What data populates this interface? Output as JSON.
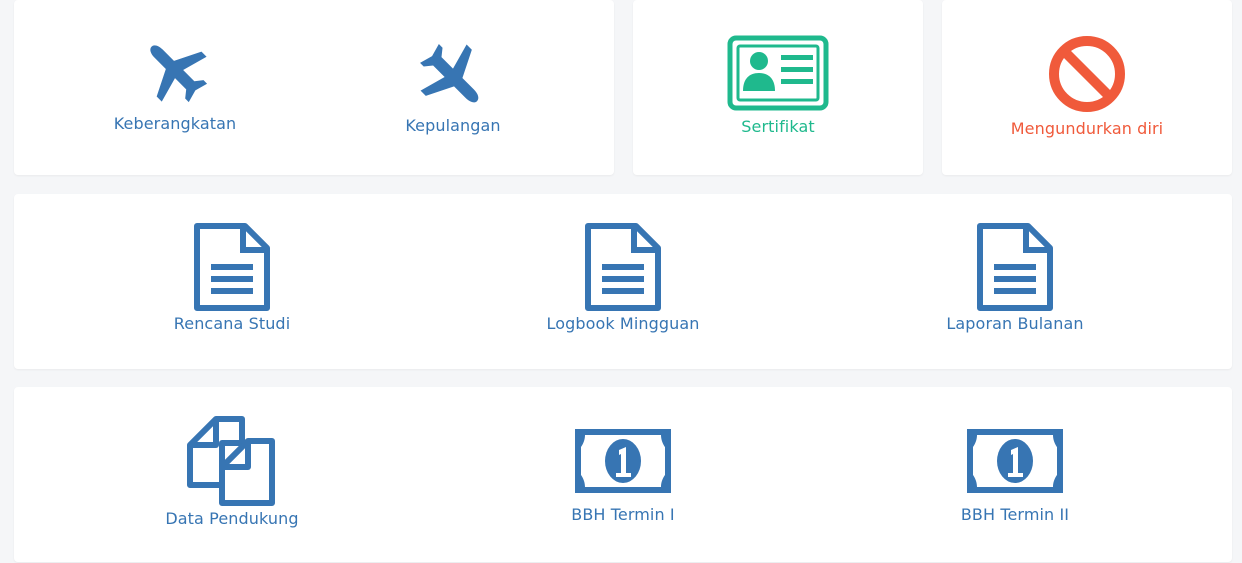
{
  "colors": {
    "primary": "#3775b3",
    "success": "#1fb98d",
    "danger": "#f05a3b",
    "background": "#f5f6f8",
    "card": "#ffffff"
  },
  "travel": {
    "departure": {
      "label": "Keberangkatan",
      "icon": "plane-departure-icon"
    },
    "return": {
      "label": "Kepulangan",
      "icon": "plane-arrival-icon"
    }
  },
  "certificate": {
    "label": "Sertifikat",
    "icon": "id-card-icon"
  },
  "resign": {
    "label": "Mengundurkan diri",
    "icon": "ban-icon"
  },
  "reports": [
    {
      "label": "Rencana Studi",
      "icon": "document-icon"
    },
    {
      "label": "Logbook Mingguan",
      "icon": "document-icon"
    },
    {
      "label": "Laporan Bulanan",
      "icon": "document-icon"
    }
  ],
  "finance": [
    {
      "label": "Data Pendukung",
      "icon": "copy-files-icon"
    },
    {
      "label": "BBH Termin I",
      "icon": "money-bill-icon"
    },
    {
      "label": "BBH Termin II",
      "icon": "money-bill-icon"
    }
  ]
}
